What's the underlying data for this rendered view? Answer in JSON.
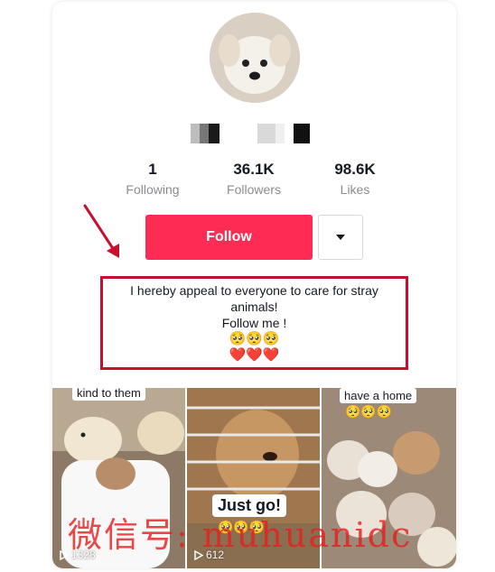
{
  "profile": {
    "stats": [
      {
        "value": "1",
        "label": "Following"
      },
      {
        "value": "36.1K",
        "label": "Followers"
      },
      {
        "value": "98.6K",
        "label": "Likes"
      }
    ],
    "follow_label": "Follow",
    "more_icon": "caret-down-icon",
    "bio_lines": [
      "I hereby appeal to everyone to care for stray",
      "animals!",
      "Follow me !"
    ],
    "bio_emoji_faces": "🥺🥺🥺",
    "bio_emoji_hearts": "❤️❤️❤️"
  },
  "videos": [
    {
      "caption": "kind to them",
      "views": "1328"
    },
    {
      "caption": "Just go!",
      "caption_emoji": "🥺🥺🥺",
      "views": "612"
    },
    {
      "caption": "have a home",
      "caption_emoji": "🥺🥺🥺"
    }
  ],
  "watermark": "微信号: muhuanidc",
  "colors": {
    "accent": "#fe2c55",
    "annotation": "#c8102e",
    "muted_text": "#8a8b91"
  }
}
